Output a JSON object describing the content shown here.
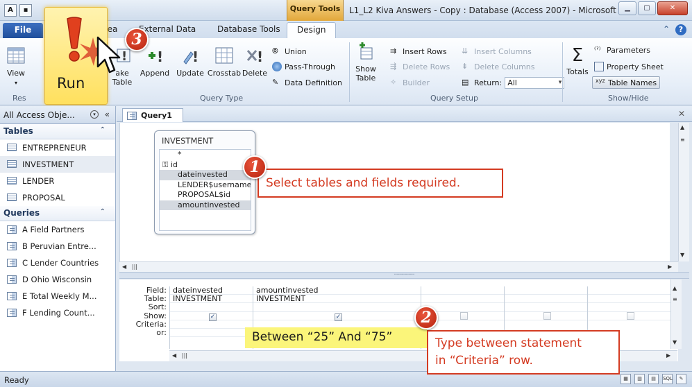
{
  "window": {
    "context_tab": "Query Tools",
    "title": "L1_L2 Kiva Answers - Copy : Database (Access 2007) - Microsoft ...",
    "qat": [
      "A",
      "▪"
    ]
  },
  "tabs": {
    "file": "File",
    "items": [
      "rea",
      "External Data",
      "Database Tools"
    ],
    "active": "Design"
  },
  "ribbon": {
    "results_group": {
      "view": "View",
      "run": "Run",
      "label": "Res"
    },
    "query_type": {
      "make_table": "ake\nTable",
      "append": "Append",
      "update": "Update",
      "crosstab": "Crosstab",
      "delete": "Delete",
      "union": "Union",
      "pass_through": "Pass-Through",
      "data_definition": "Data Definition",
      "label": "Query Type"
    },
    "query_setup": {
      "show_table": "Show Table",
      "insert_rows": "Insert Rows",
      "delete_rows": "Delete Rows",
      "builder": "Builder",
      "insert_columns": "Insert Columns",
      "delete_columns": "Delete Columns",
      "return_label": "Return:",
      "return_value": "All",
      "label": "Query Setup"
    },
    "show_hide": {
      "totals": "Totals",
      "parameters": "Parameters",
      "property_sheet": "Property Sheet",
      "table_names": "Table Names",
      "label": "Show/Hide"
    }
  },
  "nav": {
    "header": "All Access Obje...",
    "tables_label": "Tables",
    "tables": [
      "ENTREPRENEUR",
      "INVESTMENT",
      "LENDER",
      "PROPOSAL"
    ],
    "queries_label": "Queries",
    "queries": [
      "A Field Partners",
      "B Peruvian Entre...",
      "C Lender Countries",
      "D Ohio Wisconsin",
      "E Total Weekly M...",
      "F Lending Count..."
    ]
  },
  "document": {
    "tab": "Query1",
    "table_box": {
      "title": "INVESTMENT",
      "fields": [
        "*",
        "id",
        "dateinvested",
        "LENDER$username",
        "PROPOSAL$id",
        "amountinvested"
      ]
    }
  },
  "grid": {
    "row_labels": [
      "Field:",
      "Table:",
      "Sort:",
      "Show:",
      "Criteria:",
      "or:"
    ],
    "columns": [
      {
        "field": "dateinvested",
        "table": "INVESTMENT"
      },
      {
        "field": "amountinvested",
        "table": "INVESTMENT"
      }
    ]
  },
  "annotations": {
    "step1": "Select tables and fields required.",
    "step2_line1": "Type between statement",
    "step2_line2": "in “Criteria” row.",
    "criteria_text": "Between “25” And “75”",
    "badge1": "1",
    "badge2": "2",
    "badge3": "3"
  },
  "status": {
    "text": "Ready"
  },
  "colors": {
    "callout_red": "#d43b22",
    "highlight_yellow": "#fbf57a",
    "run_gold": "#ffe05e"
  }
}
